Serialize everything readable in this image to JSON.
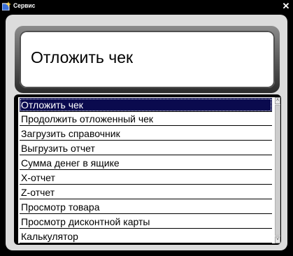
{
  "window": {
    "title": "Сервис",
    "close_glyph": "✕",
    "icon": "sparkle-app-icon"
  },
  "header": {
    "selected_title": "Отложить чек"
  },
  "menu": {
    "items": [
      {
        "label": "Отложить чек",
        "selected": true
      },
      {
        "label": "Продолжить отложенный чек",
        "selected": false
      },
      {
        "label": "Загрузить справочник",
        "selected": false
      },
      {
        "label": "Выгрузить отчет",
        "selected": false
      },
      {
        "label": "Сумма денег в ящике",
        "selected": false
      },
      {
        "label": "X-отчет",
        "selected": false
      },
      {
        "label": "Z-отчет",
        "selected": false
      },
      {
        "label": "Просмотр товара",
        "selected": false
      },
      {
        "label": "Просмотр дисконтной карты",
        "selected": false
      },
      {
        "label": "Калькулятор",
        "selected": false
      }
    ]
  },
  "scrollbar": {
    "up_glyph": "˄",
    "down_glyph": "˅"
  },
  "colors": {
    "selection_bg": "#0a0a4e",
    "frame": "#000000",
    "client_bg": "#dcdcdc"
  }
}
